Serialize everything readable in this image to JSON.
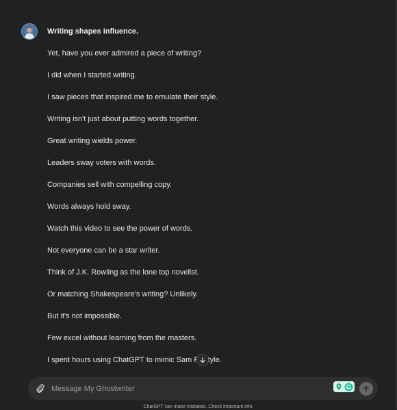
{
  "message": {
    "avatar_icon": "user-avatar-icon",
    "lines": [
      "Writing shapes influence.",
      "Yet, have you ever admired a piece of writing?",
      "I did when I started writing.",
      "I saw pieces that inspired me to emulate their style.",
      "Writing isn't just about putting words together.",
      "Great writing wields power.",
      "Leaders sway voters with words.",
      "Companies sell with compelling copy.",
      "Words always hold sway.",
      "Watch this video to see the power of words.",
      "Not everyone can be a star writer.",
      "Think of J.K. Rowling as the lone top novelist.",
      "Or matching Shakespeare's writing? Unlikely.",
      "But it's not impossible.",
      "Few excel without learning from the masters.",
      "I spent hours using ChatGPT to mimic Sam Par  tyle."
    ]
  },
  "scroll_down_icon": "arrow-down-icon",
  "composer": {
    "placeholder": "Message My Ghostwriter",
    "value": "",
    "attach_icon": "paperclip-icon",
    "extension_icon": "grammar-extension-icon",
    "send_icon": "arrow-up-icon"
  },
  "disclaimer": "ChatGPT can make mistakes. Check important info.",
  "colors": {
    "background": "#212121",
    "composer_bg": "#2f2f2f",
    "text": "#e6e6e6",
    "placeholder": "#9b9b9b",
    "send_button": "#676767"
  }
}
